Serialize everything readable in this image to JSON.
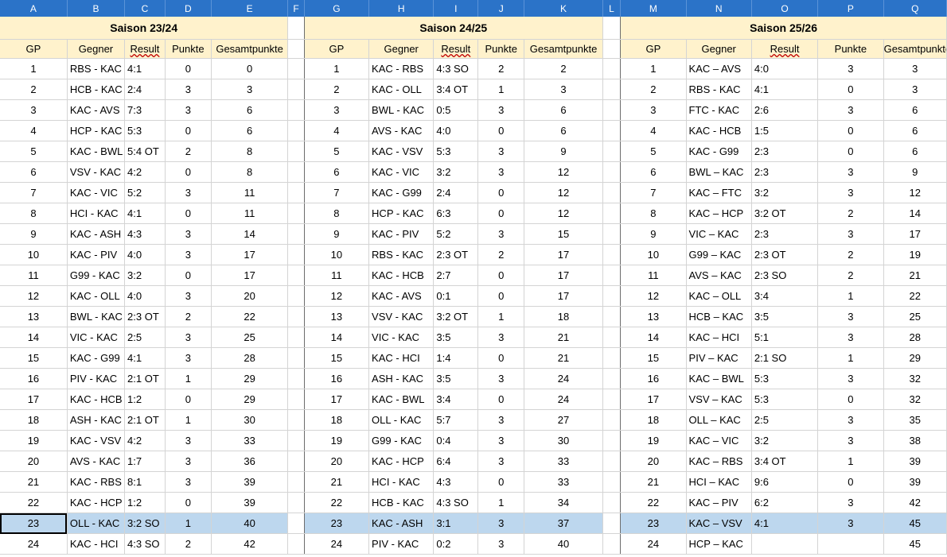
{
  "column_letters": [
    "A",
    "B",
    "C",
    "D",
    "E",
    "F",
    "G",
    "H",
    "I",
    "J",
    "K",
    "L",
    "M",
    "N",
    "O",
    "P",
    "Q"
  ],
  "seasons": [
    {
      "title": "Saison 23/24",
      "headers": [
        "GP",
        "Gegner",
        "Result",
        "Punkte",
        "Gesamtpunkte"
      ],
      "rows": [
        [
          "1",
          "RBS - KAC",
          "4:1",
          "0",
          "0"
        ],
        [
          "2",
          "HCB - KAC",
          "2:4",
          "3",
          "3"
        ],
        [
          "3",
          "KAC - AVS",
          "7:3",
          "3",
          "6"
        ],
        [
          "4",
          "HCP - KAC",
          "5:3",
          "0",
          "6"
        ],
        [
          "5",
          "KAC - BWL",
          "5:4 OT",
          "2",
          "8"
        ],
        [
          "6",
          "VSV - KAC",
          "4:2",
          "0",
          "8"
        ],
        [
          "7",
          "KAC - VIC",
          "5:2",
          "3",
          "11"
        ],
        [
          "8",
          "HCI - KAC",
          "4:1",
          "0",
          "11"
        ],
        [
          "9",
          "KAC - ASH",
          "4:3",
          "3",
          "14"
        ],
        [
          "10",
          "KAC - PIV",
          "4:0",
          "3",
          "17"
        ],
        [
          "11",
          "G99 - KAC",
          "3:2",
          "0",
          "17"
        ],
        [
          "12",
          "KAC - OLL",
          "4:0",
          "3",
          "20"
        ],
        [
          "13",
          "BWL - KAC",
          "2:3 OT",
          "2",
          "22"
        ],
        [
          "14",
          "VIC - KAC",
          "2:5",
          "3",
          "25"
        ],
        [
          "15",
          "KAC - G99",
          "4:1",
          "3",
          "28"
        ],
        [
          "16",
          "PIV - KAC",
          "2:1 OT",
          "1",
          "29"
        ],
        [
          "17",
          "KAC - HCB",
          "1:2",
          "0",
          "29"
        ],
        [
          "18",
          "ASH - KAC",
          "2:1 OT",
          "1",
          "30"
        ],
        [
          "19",
          "KAC - VSV",
          "4:2",
          "3",
          "33"
        ],
        [
          "20",
          "AVS - KAC",
          "1:7",
          "3",
          "36"
        ],
        [
          "21",
          "KAC - RBS",
          "8:1",
          "3",
          "39"
        ],
        [
          "22",
          "KAC - HCP",
          "1:2",
          "0",
          "39"
        ],
        [
          "23",
          "OLL - KAC",
          "3:2 SO",
          "1",
          "40"
        ],
        [
          "24",
          "KAC - HCI",
          "4:3 SO",
          "2",
          "42"
        ]
      ]
    },
    {
      "title": "Saison 24/25",
      "headers": [
        "GP",
        "Gegner",
        "Result",
        "Punkte",
        "Gesamtpunkte"
      ],
      "rows": [
        [
          "1",
          "KAC - RBS",
          "4:3 SO",
          "2",
          "2"
        ],
        [
          "2",
          "KAC - OLL",
          "3:4 OT",
          "1",
          "3"
        ],
        [
          "3",
          "BWL - KAC",
          "0:5",
          "3",
          "6"
        ],
        [
          "4",
          "AVS - KAC",
          "4:0",
          "0",
          "6"
        ],
        [
          "5",
          "KAC - VSV",
          "5:3",
          "3",
          "9"
        ],
        [
          "6",
          "KAC - VIC",
          "3:2",
          "3",
          "12"
        ],
        [
          "7",
          "KAC - G99",
          "2:4",
          "0",
          "12"
        ],
        [
          "8",
          "HCP - KAC",
          "6:3",
          "0",
          "12"
        ],
        [
          "9",
          "KAC - PIV",
          "5:2",
          "3",
          "15"
        ],
        [
          "10",
          "RBS - KAC",
          "2:3 OT",
          "2",
          "17"
        ],
        [
          "11",
          "KAC - HCB",
          "2:7",
          "0",
          "17"
        ],
        [
          "12",
          "KAC - AVS",
          "0:1",
          "0",
          "17"
        ],
        [
          "13",
          "VSV - KAC",
          "3:2 OT",
          "1",
          "18"
        ],
        [
          "14",
          "VIC - KAC",
          "3:5",
          "3",
          "21"
        ],
        [
          "15",
          "KAC - HCI",
          "1:4",
          "0",
          "21"
        ],
        [
          "16",
          "ASH - KAC",
          "3:5",
          "3",
          "24"
        ],
        [
          "17",
          "KAC - BWL",
          "3:4",
          "0",
          "24"
        ],
        [
          "18",
          "OLL - KAC",
          "5:7",
          "3",
          "27"
        ],
        [
          "19",
          "G99 - KAC",
          "0:4",
          "3",
          "30"
        ],
        [
          "20",
          "KAC - HCP",
          "6:4",
          "3",
          "33"
        ],
        [
          "21",
          "HCI - KAC",
          "4:3",
          "0",
          "33"
        ],
        [
          "22",
          "HCB - KAC",
          "4:3 SO",
          "1",
          "34"
        ],
        [
          "23",
          "KAC - ASH",
          "3:1",
          "3",
          "37"
        ],
        [
          "24",
          "PIV - KAC",
          "0:2",
          "3",
          "40"
        ]
      ]
    },
    {
      "title": "Saison 25/26",
      "headers": [
        "GP",
        "Gegner",
        "Result",
        "Punkte",
        "Gesamtpunkte"
      ],
      "rows": [
        [
          "1",
          "KAC – AVS",
          "4:0",
          "3",
          "3"
        ],
        [
          "2",
          "RBS - KAC",
          "4:1",
          "0",
          "3"
        ],
        [
          "3",
          "FTC - KAC",
          "2:6",
          "3",
          "6"
        ],
        [
          "4",
          "KAC - HCB",
          "1:5",
          "0",
          "6"
        ],
        [
          "5",
          "KAC - G99",
          "2:3",
          "0",
          "6"
        ],
        [
          "6",
          "BWL – KAC",
          "2:3",
          "3",
          "9"
        ],
        [
          "7",
          "KAC – FTC",
          "3:2",
          "3",
          "12"
        ],
        [
          "8",
          "KAC – HCP",
          "3:2 OT",
          "2",
          "14"
        ],
        [
          "9",
          "VIC – KAC",
          "2:3",
          "3",
          "17"
        ],
        [
          "10",
          "G99 – KAC",
          "2:3 OT",
          "2",
          "19"
        ],
        [
          "11",
          "AVS – KAC",
          "2:3 SO",
          "2",
          "21"
        ],
        [
          "12",
          "KAC – OLL",
          "3:4",
          "1",
          "22"
        ],
        [
          "13",
          "HCB – KAC",
          "3:5",
          "3",
          "25"
        ],
        [
          "14",
          "KAC – HCI",
          "5:1",
          "3",
          "28"
        ],
        [
          "15",
          "PIV – KAC",
          "2:1 SO",
          "1",
          "29"
        ],
        [
          "16",
          "KAC – BWL",
          "5:3",
          "3",
          "32"
        ],
        [
          "17",
          "VSV – KAC",
          "5:3",
          "0",
          "32"
        ],
        [
          "18",
          "OLL – KAC",
          "2:5",
          "3",
          "35"
        ],
        [
          "19",
          "KAC – VIC",
          "3:2",
          "3",
          "38"
        ],
        [
          "20",
          "KAC – RBS",
          "3:4 OT",
          "1",
          "39"
        ],
        [
          "21",
          "HCI – KAC",
          "9:6",
          "0",
          "39"
        ],
        [
          "22",
          "KAC – PIV",
          "6:2",
          "3",
          "42"
        ],
        [
          "23",
          "KAC – VSV",
          "4:1",
          "3",
          "45"
        ],
        [
          "24",
          "HCP – KAC",
          "",
          "",
          "45"
        ]
      ]
    }
  ],
  "selected_row_index": 22,
  "colors": {
    "column_header_bg": "#2b73c8",
    "season_header_bg": "#fff2cc",
    "selected_row_bg": "#bdd7ee"
  }
}
